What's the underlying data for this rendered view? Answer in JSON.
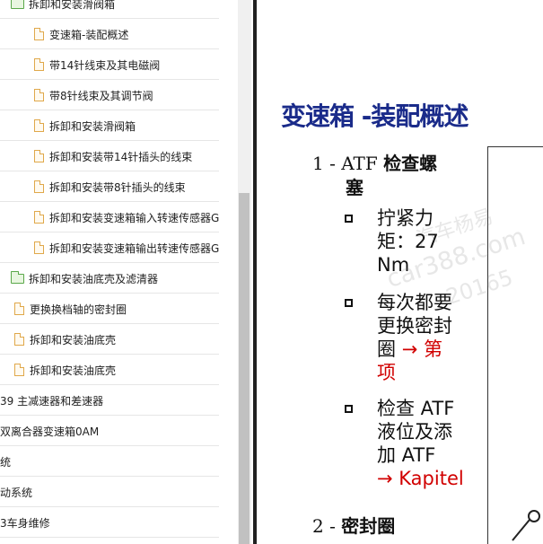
{
  "tree": {
    "items": [
      {
        "label": "拆卸和安装滑阀箱",
        "type": "folder",
        "indent": 12
      },
      {
        "label": "变速箱-装配概述",
        "type": "file",
        "indent": 38
      },
      {
        "label": "带14针线束及其电磁阀",
        "type": "file",
        "indent": 38
      },
      {
        "label": "带8针线束及其调节阀",
        "type": "file",
        "indent": 38
      },
      {
        "label": "拆卸和安装滑阀箱",
        "type": "file",
        "indent": 38
      },
      {
        "label": "拆卸和安装带14针插头的线束",
        "type": "file",
        "indent": 38
      },
      {
        "label": "拆卸和安装带8针插头的线束",
        "type": "file",
        "indent": 38
      },
      {
        "label": "拆卸和安装变速箱输入转速传感器G",
        "type": "file",
        "indent": 38
      },
      {
        "label": "拆卸和安装变速箱输出转速传感器G",
        "type": "file",
        "indent": 38
      },
      {
        "label": "拆卸和安装油底壳及滤清器",
        "type": "folder",
        "indent": 12
      },
      {
        "label": "更换换档轴的密封圈",
        "type": "file",
        "indent": 16
      },
      {
        "label": "拆卸和安装油底壳",
        "type": "file",
        "indent": 16
      },
      {
        "label": "拆卸和安装油底壳",
        "type": "file",
        "indent": 16
      },
      {
        "label": "39 主减速器和差速器",
        "type": "none",
        "indent": 0
      },
      {
        "label": "双离合器变速箱0AM",
        "type": "none",
        "indent": 0
      },
      {
        "label": "统",
        "type": "none",
        "indent": 0
      },
      {
        "label": "动系统",
        "type": "none",
        "indent": 0
      },
      {
        "label": "3车身维修",
        "type": "none",
        "indent": 0
      }
    ]
  },
  "doc": {
    "title": "变速箱 -装配概述",
    "item1_num": "1 - ATF ",
    "item1_title": "检查螺",
    "item1_title2": "塞",
    "bullet1": [
      "拧紧力",
      "矩：27",
      "Nm"
    ],
    "bullet2": [
      "每次都要",
      "更换密封",
      "圈"
    ],
    "bullet2_link": "→ 第",
    "bullet2_link2": "项",
    "bullet3": [
      "检查 ATF",
      "液位及添",
      "加 ATF"
    ],
    "bullet3_link": "→ Kapitel",
    "item2_num": "2 - ",
    "item2_title": "密封圈"
  },
  "watermark": {
    "line1": "汽车杨易",
    "line2": "car388.com",
    "line3": "20165"
  }
}
